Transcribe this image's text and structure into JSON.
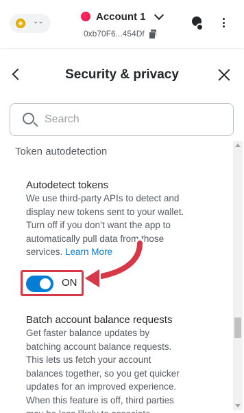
{
  "header": {
    "network_icon": "bnb-coin-icon",
    "account_name": "Account 1",
    "address": "0xb70F6...454Df",
    "icons": [
      "chevron-down-icon",
      "copy-icon",
      "globe-icon",
      "kebab-menu-icon"
    ]
  },
  "titlebar": {
    "title": "Security & privacy",
    "back_icon": "back-arrow-icon",
    "close_icon": "close-icon"
  },
  "search": {
    "placeholder": "Search",
    "value": ""
  },
  "section": {
    "heading": "Token autodetection"
  },
  "autodetect": {
    "title": "Autodetect tokens",
    "description_lines": [
      "We use third-party APIs to detect and",
      "display new tokens sent to your wallet.",
      "Turn off if you don’t want the app to",
      "automatically pull data from those",
      "services."
    ],
    "learn_more": "Learn More",
    "toggle_state": "ON",
    "toggle_on": true
  },
  "batch": {
    "title": "Batch account balance requests",
    "description_lines": [
      "Get faster balance updates by",
      "batching account balance requests.",
      "This lets us fetch your account",
      "balances together, so you get quicker",
      "updates for an improved experience.",
      "When this feature is off, third parties",
      "may be less likely to associate..."
    ]
  },
  "colors": {
    "accent": "#037dd6",
    "highlight": "#d73847",
    "text": "#24272a",
    "muted": "#535a61"
  }
}
